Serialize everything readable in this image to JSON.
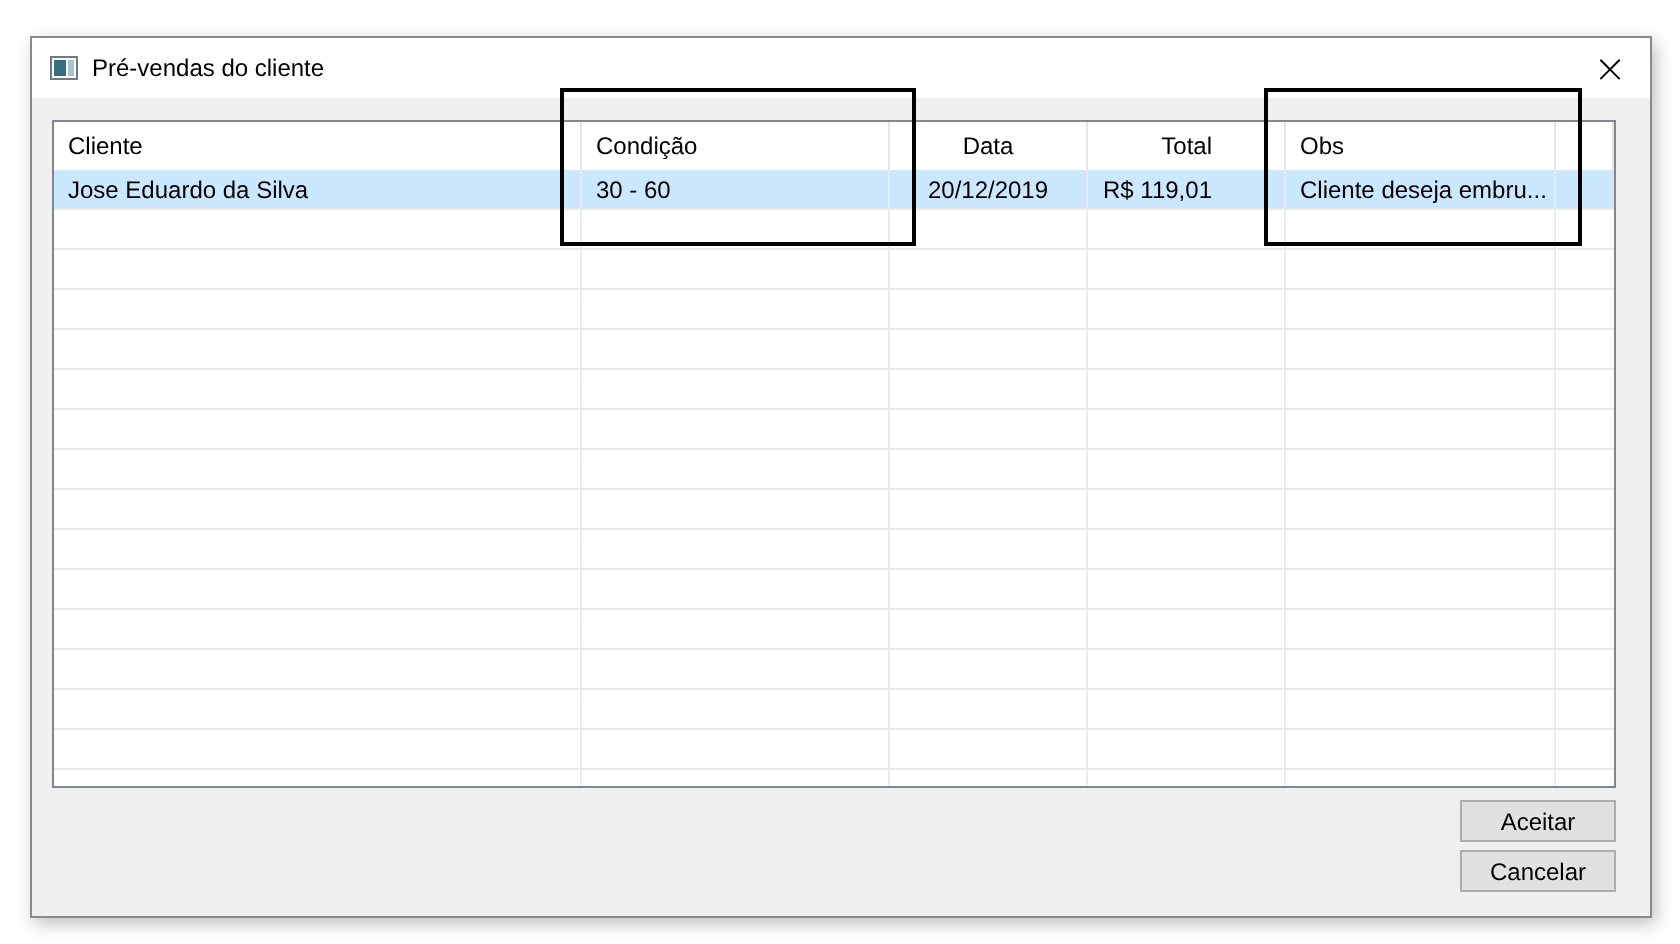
{
  "window": {
    "title": "Pré-vendas do cliente",
    "close": "×"
  },
  "table": {
    "columns": [
      {
        "label": "Cliente",
        "annotated": false
      },
      {
        "label": "Condição",
        "annotated": true
      },
      {
        "label": "Data",
        "annotated": false
      },
      {
        "label": "Total",
        "annotated": false
      },
      {
        "label": "Obs",
        "annotated": true
      }
    ],
    "rows": [
      {
        "selected": true,
        "cells": [
          "Jose Eduardo da Silva",
          "30 - 60",
          "20/12/2019",
          "R$ 119,01",
          "Cliente deseja embru..."
        ]
      }
    ]
  },
  "buttons": [
    "Aceitar",
    "Cancelar"
  ]
}
